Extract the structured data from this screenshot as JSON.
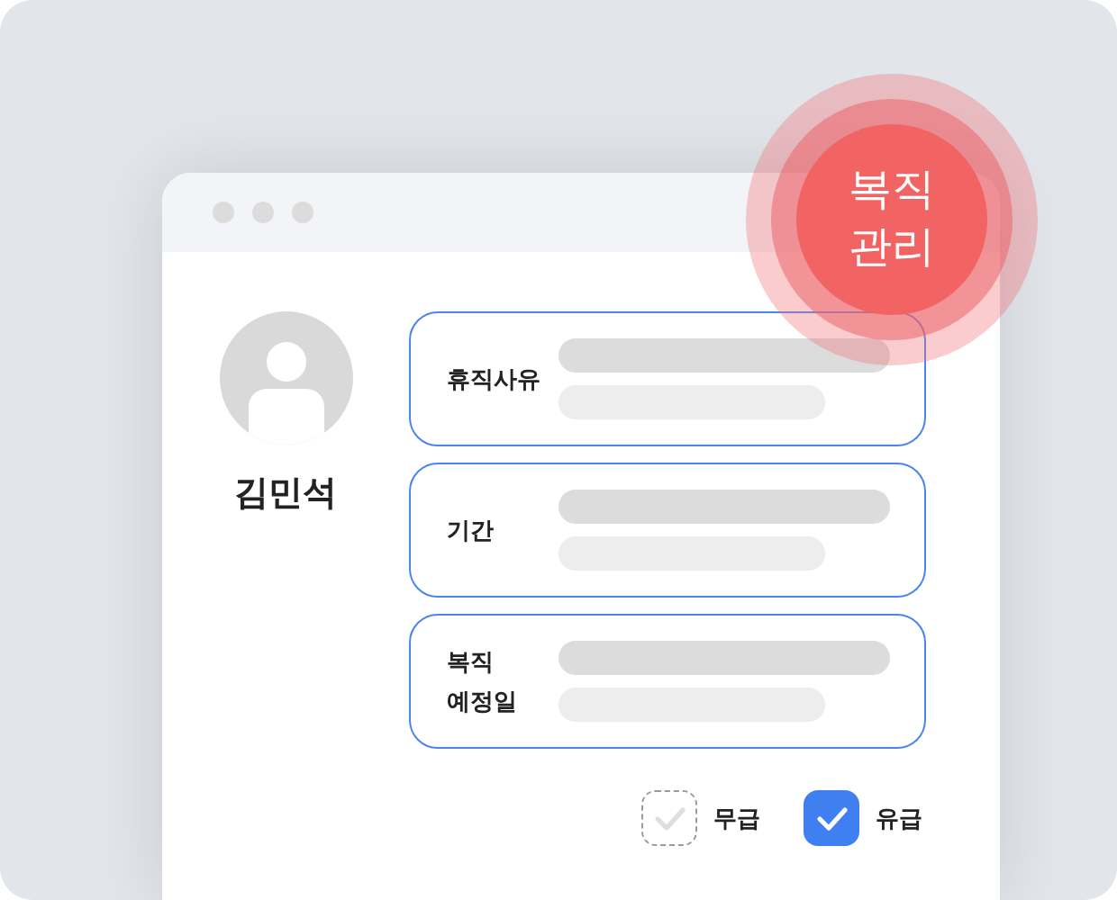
{
  "badge": {
    "text": "복직 관리"
  },
  "profile": {
    "name": "김민석"
  },
  "fields": [
    {
      "label": "휴직사유"
    },
    {
      "label": "기간"
    },
    {
      "label": "복직 예정일"
    }
  ],
  "pay_options": [
    {
      "label": "무급",
      "checked": false
    },
    {
      "label": "유급",
      "checked": true
    }
  ]
}
